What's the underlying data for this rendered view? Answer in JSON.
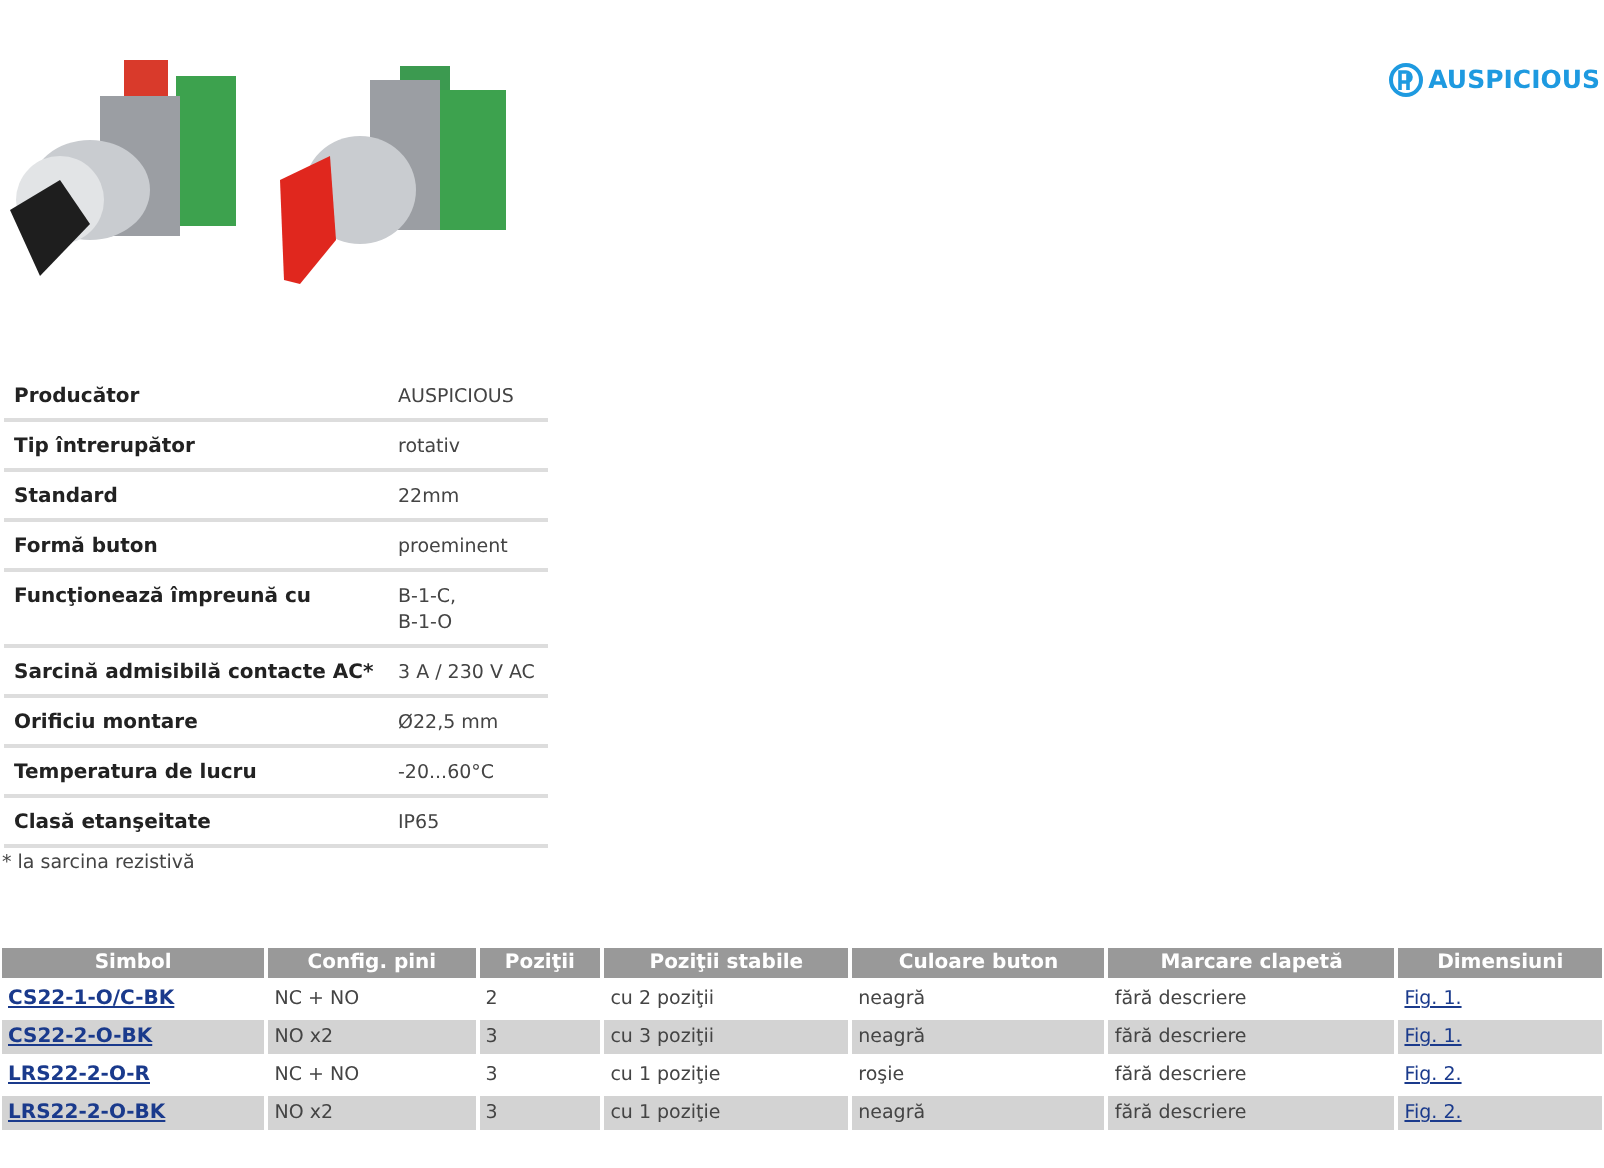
{
  "brand_logo": {
    "text": "AUSPICIOUS"
  },
  "specs": [
    {
      "label": "Producător",
      "value": [
        "AUSPICIOUS"
      ]
    },
    {
      "label": "Tip întrerupător",
      "value": [
        "rotativ"
      ]
    },
    {
      "label": "Standard",
      "value": [
        "22mm"
      ]
    },
    {
      "label": "Formă buton",
      "value": [
        "proeminent"
      ]
    },
    {
      "label": "Funcţionează împreună cu",
      "value": [
        "B-1-C,",
        "B-1-O"
      ]
    },
    {
      "label": "Sarcină admisibilă contacte AC*",
      "value": [
        "3 A / 230 V AC"
      ]
    },
    {
      "label": "Orificiu montare",
      "value": [
        "Ø22,5 mm"
      ]
    },
    {
      "label": "Temperatura de lucru",
      "value": [
        "-20...60°C"
      ]
    },
    {
      "label": "Clasă etanşeitate",
      "value": [
        "IP65"
      ]
    }
  ],
  "footnote": "* la sarcina rezistivă",
  "variants": {
    "columns": [
      "Simbol",
      "Config. pini",
      "Poziţii",
      "Poziţii stabile",
      "Culoare buton",
      "Marcare clapetă",
      "Dimensiuni"
    ],
    "rows": [
      [
        "CS22-1-O/C-BK",
        "NC + NO",
        "2",
        "cu 2 poziţii",
        "neagră",
        "fără descriere",
        "Fig. 1."
      ],
      [
        "CS22-2-O-BK",
        "NO x2",
        "3",
        "cu 3 poziţii",
        "neagră",
        "fără descriere",
        "Fig. 1."
      ],
      [
        "LRS22-2-O-R",
        "NC + NO",
        "3",
        "cu 1 poziţie",
        "roşie",
        "fără descriere",
        "Fig. 2."
      ],
      [
        "LRS22-2-O-BK",
        "NO x2",
        "3",
        "cu 1 poziţie",
        "neagră",
        "fără descriere",
        "Fig. 2."
      ]
    ]
  }
}
